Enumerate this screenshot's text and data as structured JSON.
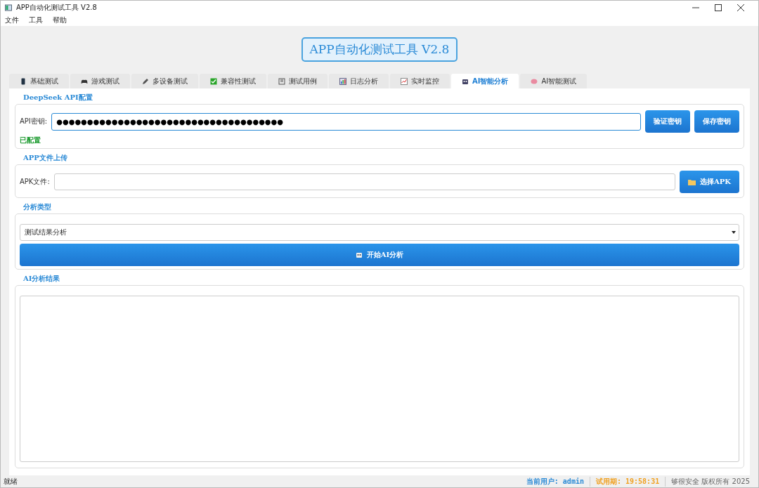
{
  "window": {
    "title": "APP自动化测试工具 V2.8"
  },
  "menu": [
    "文件",
    "工具",
    "帮助"
  ],
  "header": {
    "title": "APP自动化测试工具 V2.8"
  },
  "tabs": [
    {
      "label": "基础测试",
      "selected": false
    },
    {
      "label": "游戏测试",
      "selected": false
    },
    {
      "label": "多设备测试",
      "selected": false
    },
    {
      "label": "兼容性测试",
      "selected": false
    },
    {
      "label": "测试用例",
      "selected": false
    },
    {
      "label": "日志分析",
      "selected": false
    },
    {
      "label": "实时监控",
      "selected": false
    },
    {
      "label": "AI智能分析",
      "selected": true
    },
    {
      "label": "AI智能测试",
      "selected": false
    }
  ],
  "api_group": {
    "title": "DeepSeek API配置",
    "label": "API密钥:",
    "value": "●●●●●●●●●●●●●●●●●●●●●●●●●●●●●●●●●●●●●",
    "buttons": [
      "验证密钥",
      "保存密钥"
    ],
    "status": "已配置"
  },
  "upload_group": {
    "title": "APP文件上传",
    "label": "APK文件:",
    "button": "选择APK"
  },
  "type_group": {
    "title": "分析类型",
    "selected_option": "测试结果分析",
    "button": "开始AI分析"
  },
  "result_group": {
    "title": "AI分析结果"
  },
  "status_bar": {
    "message": "就绪",
    "user_label": "当前用户:",
    "user": "admin",
    "trial_label": "试用期:",
    "trial": "19:58:31",
    "copyright": "够很安全 版权所有 2025"
  }
}
